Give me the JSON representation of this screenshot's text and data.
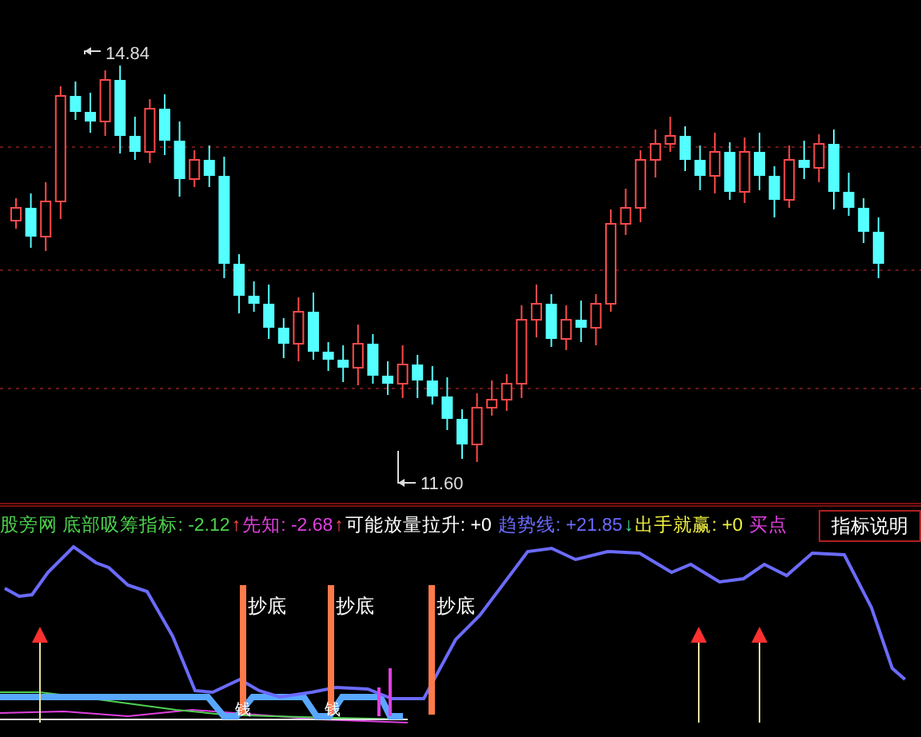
{
  "price_chart": {
    "high_label": "14.84",
    "low_label": "11.60"
  },
  "indicator_bar": {
    "items": [
      {
        "kind": "text",
        "text": "股旁网 底部吸筹指标: -2.12",
        "color": "#4cd24c"
      },
      {
        "kind": "arrow",
        "text": "↑",
        "color": "#ff4a4a"
      },
      {
        "kind": "text",
        "text": "先知: -2.68",
        "color": "#e040e0"
      },
      {
        "kind": "arrow",
        "text": "↑",
        "color": "#ff4a4a"
      },
      {
        "kind": "text",
        "text": "可能放量拉升: +0",
        "color": "#ffffff"
      },
      {
        "kind": "text",
        "text": "趋势线: +21.85",
        "color": "#6b6bff"
      },
      {
        "kind": "arrow",
        "text": "↓",
        "color": "#40e0a0"
      },
      {
        "kind": "text",
        "text": "出手就赢: +0",
        "color": "#f0f040"
      },
      {
        "kind": "text",
        "text": "买点",
        "color": "#e040e0"
      }
    ],
    "button": "指标说明"
  },
  "lower_panel": {
    "signals": [
      {
        "label": "抄底"
      },
      {
        "label": "抄底"
      },
      {
        "label": "抄底"
      }
    ],
    "tags": [
      {
        "label": "钱"
      },
      {
        "label": "钱"
      }
    ]
  }
}
